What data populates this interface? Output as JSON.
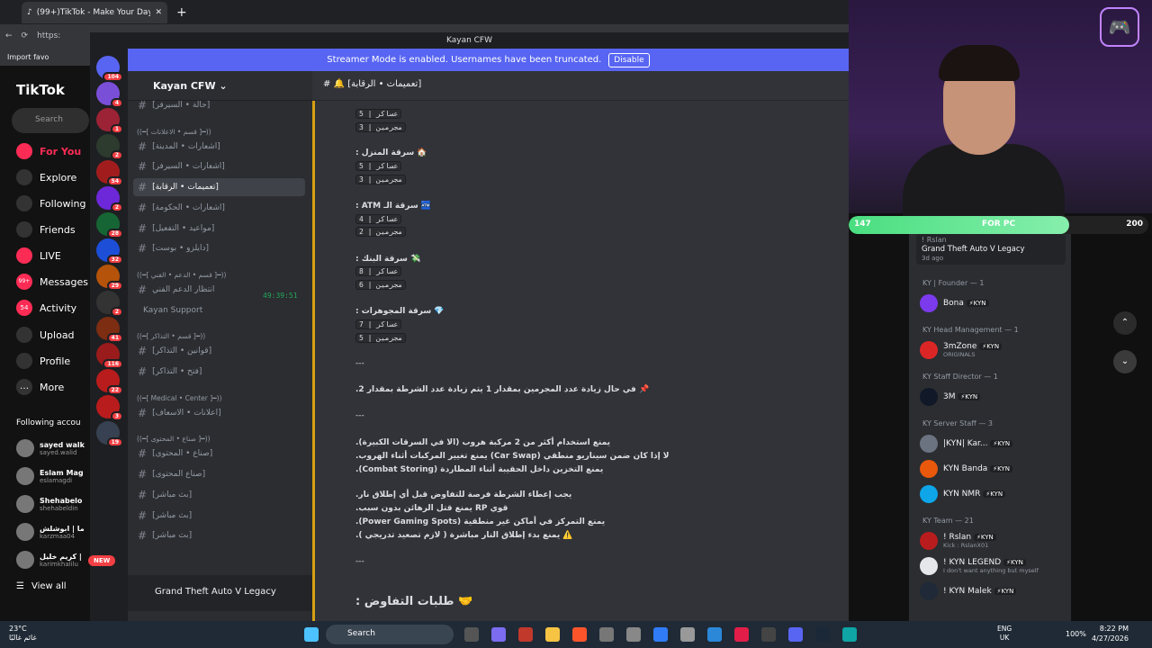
{
  "browser": {
    "tab_title": "(99+)TikTok - Make Your Day",
    "url": "https:",
    "bookmark": "Import favo"
  },
  "tiktok": {
    "logo": "TikTok",
    "search": "Search",
    "nav": [
      "For You",
      "Explore",
      "Following",
      "Friends",
      "LIVE",
      "Messages",
      "Activity",
      "Upload",
      "Profile",
      "More"
    ],
    "nav_badges": {
      "messages": "99+",
      "activity": "54"
    },
    "following_title": "Following accou",
    "accounts": [
      {
        "name": "sayed walk",
        "handle": "sayed.walid"
      },
      {
        "name": "Eslam Mag",
        "handle": "eslamagdi"
      },
      {
        "name": "Shehabelo",
        "handle": "shehabeldin"
      },
      {
        "name": "ما | ابوشلش",
        "handle": "karzmaa04"
      },
      {
        "name": "كريم خليل |",
        "handle": "karimkhalilu"
      }
    ],
    "view_all": "View all"
  },
  "discord": {
    "window_title": "Kayan CFW",
    "banner": "Streamer Mode is enabled. Usernames have been truncated.",
    "banner_button": "Disable",
    "server_name": "Kayan CFW",
    "server_badges": [
      "104",
      "4",
      "1",
      "2",
      "54",
      "2",
      "28",
      "32",
      "29",
      "2",
      "41",
      "116",
      "22",
      "3",
      "19"
    ],
    "new_label": "NEW",
    "channels": [
      {
        "cat": "",
        "name": "[حالة • السيرفر]"
      },
      {
        "cat": "((━[ قسم • الاعلانات ]━))",
        "name": "[اشعارات • المدينة]"
      },
      {
        "cat": "",
        "name": "[اشعارات • السيرفر]"
      },
      {
        "cat": "",
        "name": "[تعميمات • الرقابة]"
      },
      {
        "cat": "",
        "name": "[اشعارات • الحكومة]"
      },
      {
        "cat": "",
        "name": "[مواعيد • التفعيل]"
      },
      {
        "cat": "",
        "name": "[دايلزو • بوست]"
      },
      {
        "cat": "((━[ قسم • الدعم • الفني ]━))",
        "name": "انتظار الدعم الفني"
      },
      {
        "cat": "",
        "name": "Kayan Support"
      },
      {
        "cat": "((━[ قسم • التذاكر ]━))",
        "name": "[قوانين • التذاكر]"
      },
      {
        "cat": "",
        "name": "[فتح • التذاكر]"
      },
      {
        "cat": "((━[ Medical • Center ]━))",
        "name": "[اعلانات • الاسعاف]"
      },
      {
        "cat": "((━[ صناع • المحتوى ]━))",
        "name": "[صناع • المحتوى]"
      },
      {
        "cat": "",
        "name": "[صناع المحتوى]"
      },
      {
        "cat": "",
        "name": "[بث مباشر]"
      },
      {
        "cat": "",
        "name": "[بث مباشر]"
      },
      {
        "cat": "",
        "name": "[بث مباشر]"
      }
    ],
    "timer": "49:39:51",
    "game": "Grand Theft Auto V Legacy",
    "chat_channel": "[تعميمات • الرقابة]",
    "lines": [
      {
        "t": "عساكر | 5",
        "code": true
      },
      {
        "t": "مجرمين | 3",
        "code": true
      },
      {
        "t": "🏠 سرقة المنزل :",
        "b": true
      },
      {
        "t": "عساكر | 5",
        "code": true
      },
      {
        "t": "مجرمين | 3",
        "code": true
      },
      {
        "t": "🏧 سرقة الـ ATM :",
        "b": true
      },
      {
        "t": "عساكر | 4",
        "code": true
      },
      {
        "t": "مجرمين | 2",
        "code": true
      },
      {
        "t": "💸 سرقة البنك :",
        "b": true
      },
      {
        "t": "عساكر | 8",
        "code": true
      },
      {
        "t": "مجرمين | 6",
        "code": true
      },
      {
        "t": "💎 سرقة المجوهرات :",
        "b": true
      },
      {
        "t": "عساكر | 7",
        "code": true
      },
      {
        "t": "مجرمين | 5",
        "code": true
      },
      {
        "t": "---"
      },
      {
        "t": "📌 في حال زيادة عدد المجرمين بمقدار 1 يتم زيادة عدد الشرطة بمقدار 2.",
        "b": true
      },
      {
        "t": "---"
      },
      {
        "t": "يمنع استخدام أكثر من 2 مركبة هروب (الا في السرقات الكبيرة).",
        "b": true
      },
      {
        "t": "لا إذا كان ضمن سيناريو منطقي (Car Swap) يمنع تغيير المركبات أثناء الهروب.",
        "b": true
      },
      {
        "t": "يمنع التخزين داخل الحقيبة أثناء المطاردة (Combat Storing).",
        "b": true
      },
      {
        "t": "يجب إعطاء الشرطة فرصة للتفاوض قبل أي إطلاق نار.",
        "b": true
      },
      {
        "t": "قوي RP يمنع قتل الرهائن بدون سبب.",
        "b": true
      },
      {
        "t": "يمنع التمركز في أماكن غير منطقية (Power Gaming Spots).",
        "b": true
      },
      {
        "t": "⚠️ يمنع بدء إطلاق النار مباشرة ( لازم تصعيد تدريجي ).",
        "b": true
      },
      {
        "t": "---"
      },
      {
        "t": "🤝 طلبات التفاوض :",
        "b": true
      }
    ]
  },
  "stream": {
    "bar_left": "147",
    "bar_label": "FOR PC",
    "bar_right": "200",
    "bar_fraction": 0.735
  },
  "members": {
    "activity": {
      "user": "! Rslan",
      "game": "Grand Theft Auto V Legacy",
      "time": "3d ago"
    },
    "roles": [
      {
        "name": "KY | Founder — 1",
        "members": [
          {
            "name": "Bona",
            "tag": "⚡KYN"
          }
        ]
      },
      {
        "name": "KY Head Management — 1",
        "members": [
          {
            "name": "3mZone",
            "tag": "⚡KYN",
            "sub": "ORIGINALS"
          }
        ]
      },
      {
        "name": "KY Staff Director — 1",
        "members": [
          {
            "name": "3M",
            "tag": "⚡KYN"
          }
        ]
      },
      {
        "name": "KY Server Staff — 3",
        "members": [
          {
            "name": "|KYN| Kar...",
            "tag": "⚡KYN"
          },
          {
            "name": "KYN Banda",
            "tag": "⚡KYN"
          },
          {
            "name": "KYN NMR",
            "tag": "⚡KYN"
          }
        ]
      },
      {
        "name": "KY Team — 21",
        "members": [
          {
            "name": "! Rslan",
            "tag": "⚡KYN",
            "sub": "Kick : RslanX01"
          },
          {
            "name": "! KYN LEGEND",
            "tag": "⚡KYN",
            "sub": "I don't want anything but myself"
          },
          {
            "name": "! KYN Malek",
            "tag": "⚡KYN"
          }
        ]
      }
    ]
  },
  "taskbar": {
    "weather": "23°C",
    "weather_sub": "غائم غالبًا",
    "search": "Search",
    "lang": "ENG",
    "lang2": "UK",
    "battery": "100%",
    "time": "8:22 PM",
    "date": "4/27/2026"
  }
}
